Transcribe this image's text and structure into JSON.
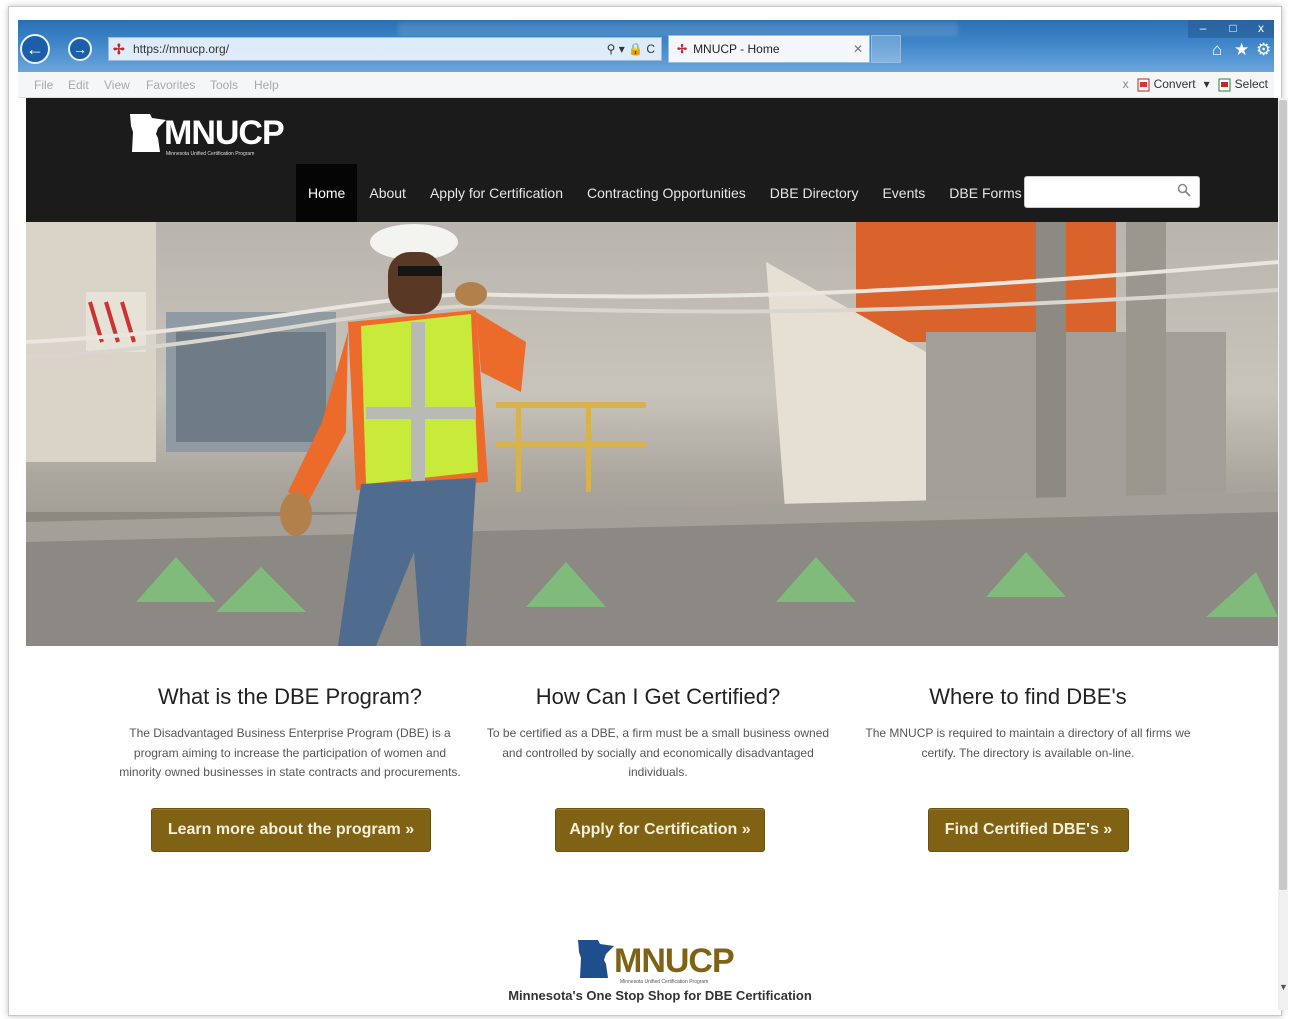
{
  "browser": {
    "url": "https://mnucp.org/",
    "tab_title": "MNUCP - Home",
    "address_tools": "⚲ ▾ 🔒 C",
    "menu": [
      "File",
      "Edit",
      "View",
      "Favorites",
      "Tools",
      "Help"
    ],
    "toolbar_close": "x",
    "convert_label": "Convert",
    "select_label": "Select"
  },
  "site": {
    "logo_text": "MNUCP",
    "logo_subtitle": "Minnesota Unified Certification Program",
    "nav": [
      "Home",
      "About",
      "Apply for Certification",
      "Contracting Opportunities",
      "DBE Directory",
      "Events",
      "DBE Forms"
    ],
    "active_nav": "Home",
    "search_value": ""
  },
  "sections": [
    {
      "heading": "What is the DBE Program?",
      "body": "The Disadvantaged Business Enterprise Program (DBE) is a program aiming to increase the participation of women and minority owned businesses in state contracts and procurements.",
      "button": "Learn more about the program »"
    },
    {
      "heading": "How Can I Get Certified?",
      "body": "To be certified as a DBE, a firm must be a small business owned and controlled by socially and economically disadvantaged individuals.",
      "button": "Apply for Certification »"
    },
    {
      "heading": "Where to find DBE's",
      "body": "The MNUCP is required to maintain a directory of all firms we certify. The directory is available on-line.",
      "button": "Find Certified DBE's »"
    }
  ],
  "footer": {
    "logo_text": "MNUCP",
    "logo_subtitle": "Minnesota Unified Certification Program",
    "tagline": "Minnesota's One Stop Shop for DBE Certification"
  },
  "colors": {
    "header_bg": "#1b1b1b",
    "button_bg": "#806215",
    "chrome_blue": "#3f86c9"
  }
}
